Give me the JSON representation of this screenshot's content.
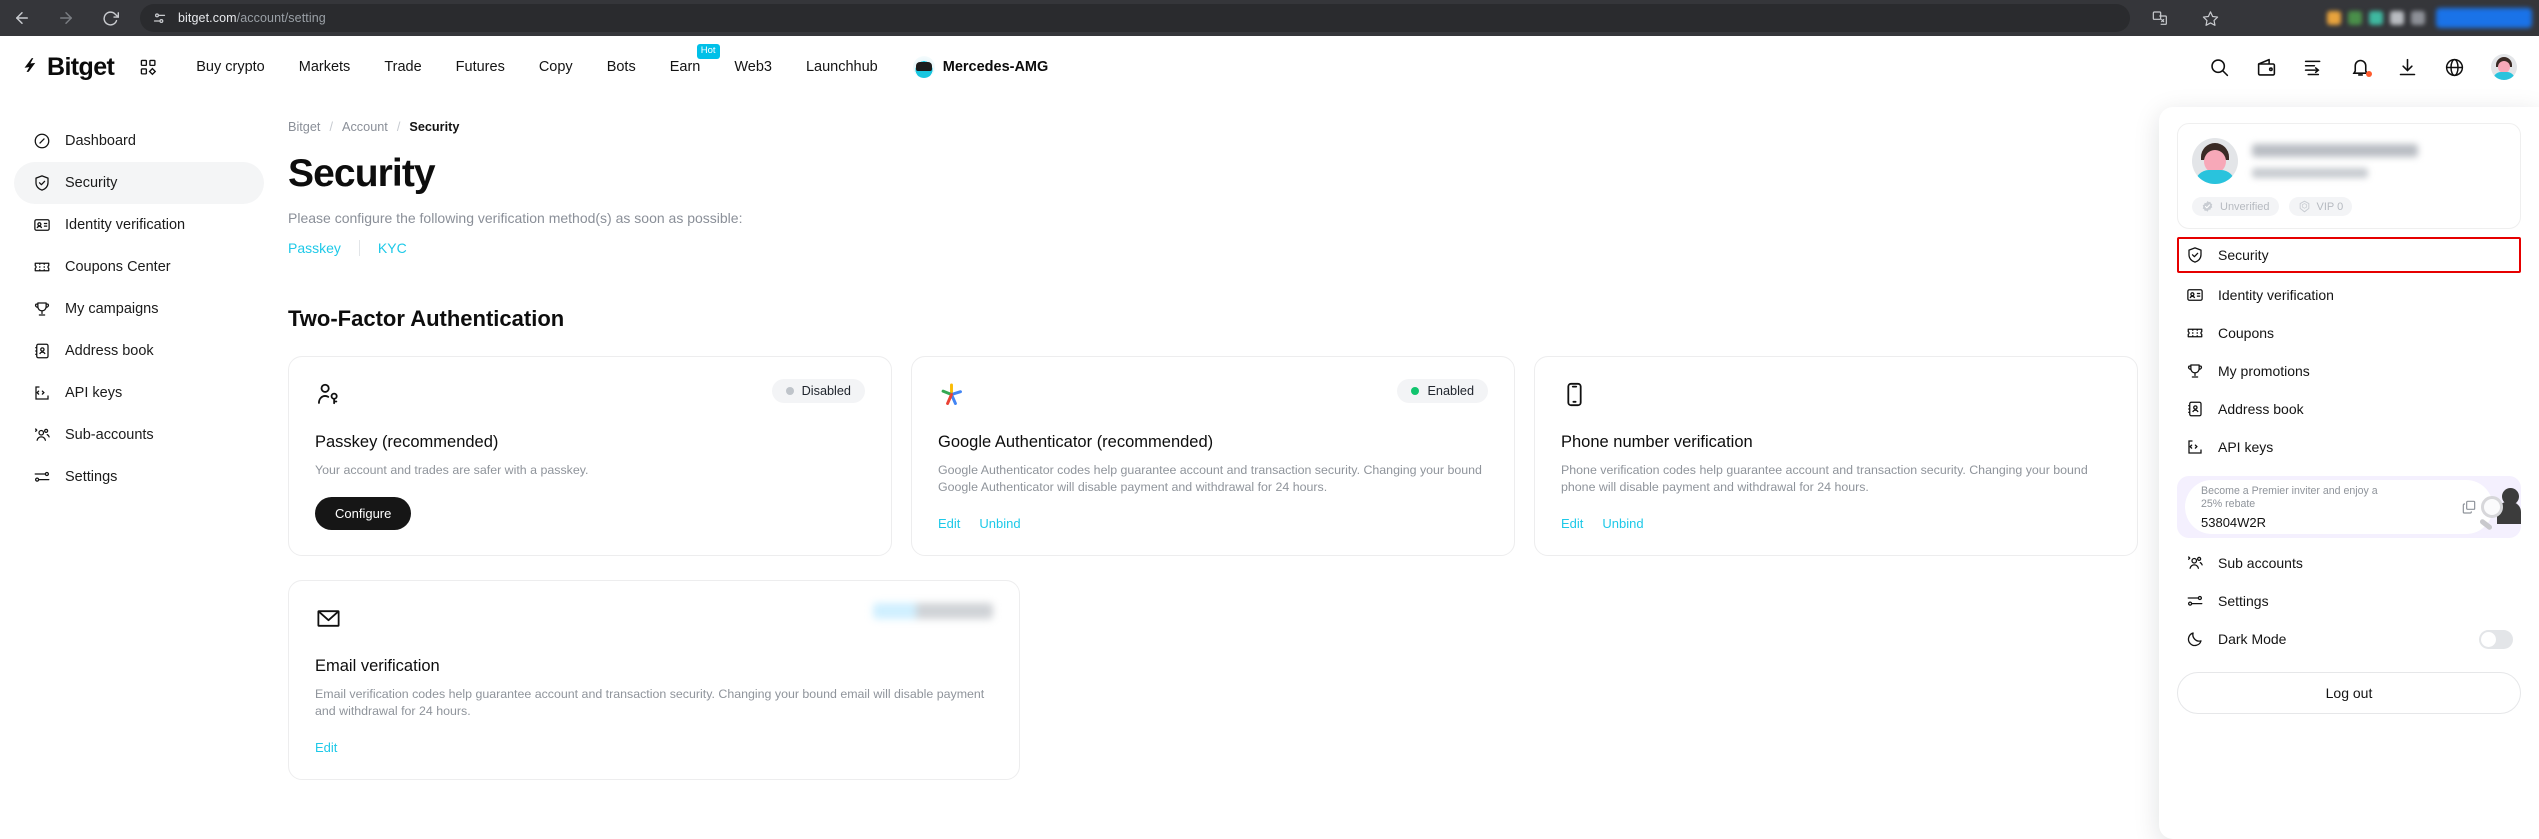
{
  "browser": {
    "url_domain": "bitget.com",
    "url_path": "/account/setting",
    "back_icon": "back-arrow-icon",
    "forward_icon": "forward-arrow-icon",
    "reload_icon": "reload-icon",
    "site_settings_icon": "site-settings-icon",
    "translate_icon": "translate-icon",
    "bookmark_icon": "bookmark-star-icon"
  },
  "header": {
    "brand": "Bitget",
    "apps_icon": "apps-grid-icon",
    "nav": [
      {
        "label": "Buy crypto",
        "badge": ""
      },
      {
        "label": "Markets",
        "badge": ""
      },
      {
        "label": "Trade",
        "badge": ""
      },
      {
        "label": "Futures",
        "badge": ""
      },
      {
        "label": "Copy",
        "badge": ""
      },
      {
        "label": "Bots",
        "badge": ""
      },
      {
        "label": "Earn",
        "badge": "Hot"
      },
      {
        "label": "Web3",
        "badge": ""
      },
      {
        "label": "Launchhub",
        "badge": ""
      }
    ],
    "partner": "Mercedes-AMG",
    "icons": [
      "search-icon",
      "wallet-icon",
      "orders-icon",
      "notification-bell-icon",
      "download-icon",
      "globe-language-icon"
    ]
  },
  "sidebar": {
    "items": [
      {
        "label": "Dashboard",
        "icon": "compass-icon",
        "active": false
      },
      {
        "label": "Security",
        "icon": "shield-check-icon",
        "active": true
      },
      {
        "label": "Identity verification",
        "icon": "id-card-icon",
        "active": false
      },
      {
        "label": "Coupons Center",
        "icon": "ticket-icon",
        "active": false
      },
      {
        "label": "My campaigns",
        "icon": "trophy-icon",
        "active": false
      },
      {
        "label": "Address book",
        "icon": "address-book-icon",
        "active": false
      },
      {
        "label": "API keys",
        "icon": "code-brackets-icon",
        "active": false
      },
      {
        "label": "Sub-accounts",
        "icon": "users-icon",
        "active": false
      },
      {
        "label": "Settings",
        "icon": "sliders-icon",
        "active": false
      }
    ]
  },
  "main": {
    "breadcrumb": {
      "root": "Bitget",
      "middle": "Account",
      "current": "Security",
      "separator": "/"
    },
    "title": "Security",
    "subtitle": "Please configure the following verification method(s) as soon as possible:",
    "quick_links": [
      "Passkey",
      "KYC"
    ],
    "section_title": "Two-Factor Authentication",
    "cards": [
      {
        "icon": "passkey-person-icon",
        "name": "Passkey (recommended)",
        "description": "Your account and trades are safer with a passkey.",
        "status": "Disabled",
        "status_type": "disabled",
        "button": "Configure",
        "links": []
      },
      {
        "icon": "google-authenticator-icon",
        "name": "Google Authenticator (recommended)",
        "description": "Google Authenticator codes help guarantee account and transaction security. Changing your bound Google Authenticator will disable payment and withdrawal for 24 hours.",
        "status": "Enabled",
        "status_type": "enabled",
        "button": "",
        "links": [
          "Edit",
          "Unbind"
        ]
      },
      {
        "icon": "phone-icon",
        "name": "Phone number verification",
        "description": "Phone verification codes help guarantee account and transaction security. Changing your bound phone will disable payment and withdrawal for 24 hours.",
        "status": "",
        "status_type": "none",
        "button": "",
        "links": [
          "Edit",
          "Unbind"
        ]
      },
      {
        "icon": "envelope-icon",
        "name": "Email verification",
        "description": "Email verification codes help guarantee account and transaction security. Changing your bound email will disable payment and withdrawal for 24 hours.",
        "status": "",
        "status_type": "masked",
        "button": "",
        "links": [
          "Edit"
        ]
      }
    ]
  },
  "dropdown": {
    "profile": {
      "avatar": "user-avatar",
      "name_masked": "",
      "uid_masked": "",
      "badges": [
        {
          "label": "Unverified",
          "icon": "verified-badge-icon"
        },
        {
          "label": "VIP 0",
          "icon": "vip-hexagon-icon"
        }
      ]
    },
    "menu": [
      {
        "label": "Security",
        "icon": "shield-check-icon",
        "highlighted": true
      },
      {
        "label": "Identity verification",
        "icon": "id-card-icon",
        "highlighted": false
      },
      {
        "label": "Coupons",
        "icon": "ticket-icon",
        "highlighted": false
      },
      {
        "label": "My promotions",
        "icon": "trophy-icon",
        "highlighted": false
      },
      {
        "label": "Address book",
        "icon": "address-book-icon",
        "highlighted": false
      },
      {
        "label": "API keys",
        "icon": "code-brackets-icon",
        "highlighted": false
      }
    ],
    "promo": {
      "line1": "Become a Premier inviter and enjoy a",
      "line2": "25% rebate",
      "code": "53804W2R",
      "copy_icon": "copy-icon"
    },
    "menu_bottom": [
      {
        "label": "Sub accounts",
        "icon": "users-icon"
      },
      {
        "label": "Settings",
        "icon": "sliders-icon"
      }
    ],
    "dark_mode": {
      "label": "Dark Mode",
      "icon": "moon-icon",
      "enabled": false
    },
    "logout": "Log out"
  },
  "colors": {
    "accent": "#1ec9e8",
    "brand_dark": "#161616",
    "status_enabled": "#11c46e",
    "status_disabled": "#bfc4ca",
    "highlight_box": "#e60000",
    "hot_badge": "#00c0e8",
    "promo_bg": "#f4f0fe"
  }
}
